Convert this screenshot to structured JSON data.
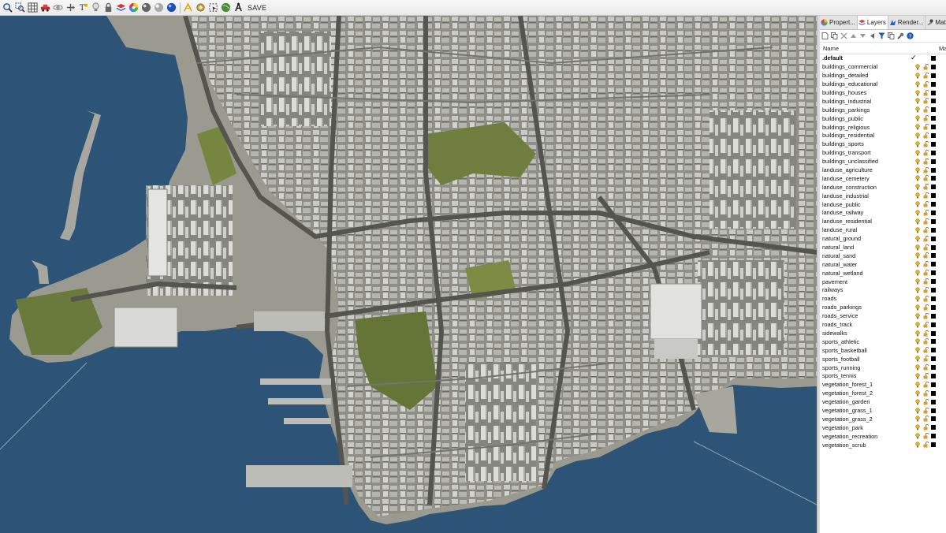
{
  "toolbar": {
    "icons": [
      "zoom-extents-icon",
      "zoom-window-icon",
      "grid-icon",
      "car-icon",
      "orbit-icon",
      "pan-icon",
      "text-icon",
      "light-icon",
      "lock-icon",
      "layer-icon",
      "color-wheel-icon",
      "sphere-icon",
      "render-icon",
      "globe-icon",
      "sun-icon",
      "gear-icon",
      "selection-icon",
      "earth-icon",
      "save-icon"
    ],
    "save_label": "SAVE"
  },
  "panel": {
    "tabs": [
      {
        "label": "Propert...",
        "icon": "properties-icon",
        "active": false
      },
      {
        "label": "Layers",
        "icon": "layers-icon",
        "active": true
      },
      {
        "label": "Render...",
        "icon": "render-tab-icon",
        "active": false
      },
      {
        "label": "Materials",
        "icon": "materials-icon",
        "active": false
      }
    ],
    "tools": [
      "new-layer-icon",
      "new-sublayer-icon",
      "delete-icon",
      "move-up-icon",
      "move-down-icon",
      "move-out-icon",
      "filter-icon",
      "copy-icon",
      "tools-icon",
      "help-icon"
    ],
    "header": {
      "name": "Name",
      "material": "Ma"
    },
    "layers": [
      ".default",
      "buildings_commercial",
      "buildings_detailed",
      "buildings_educational",
      "buildings_houses",
      "buildings_industrial",
      "buildings_parkings",
      "buildings_public",
      "buildings_religious",
      "buildings_residential",
      "buildings_sports",
      "buildings_transport",
      "buildings_unclassified",
      "landuse_agriculture",
      "landuse_cemetery",
      "landuse_construction",
      "landuse_industrial",
      "landuse_public",
      "landuse_railway",
      "landuse_residential",
      "landuse_rural",
      "natural_ground",
      "natural_land",
      "natural_sand",
      "natural_water",
      "natural_wetland",
      "pavement",
      "railways",
      "roads",
      "roads_parkings",
      "roads_service",
      "roads_track",
      "sidewalks",
      "sports_athletic",
      "sports_basketball",
      "sports_football",
      "sports_running",
      "sports_tennis",
      "vegetation_forest_1",
      "vegetation_forest_2",
      "vegetation_garden",
      "vegetation_grass_1",
      "vegetation_grass_2",
      "vegetation_park",
      "vegetation_recreation",
      "vegetation_scrub"
    ],
    "current_layer": ".default"
  },
  "colors": {
    "water": "#2d5476",
    "land": "#9a9a90",
    "building": "#d2d2cf",
    "park": "#6f7d3e",
    "road": "#5a5a57",
    "layer_color": "#000000",
    "bulb": "#e1b81e",
    "lock": "#d4a02a"
  }
}
